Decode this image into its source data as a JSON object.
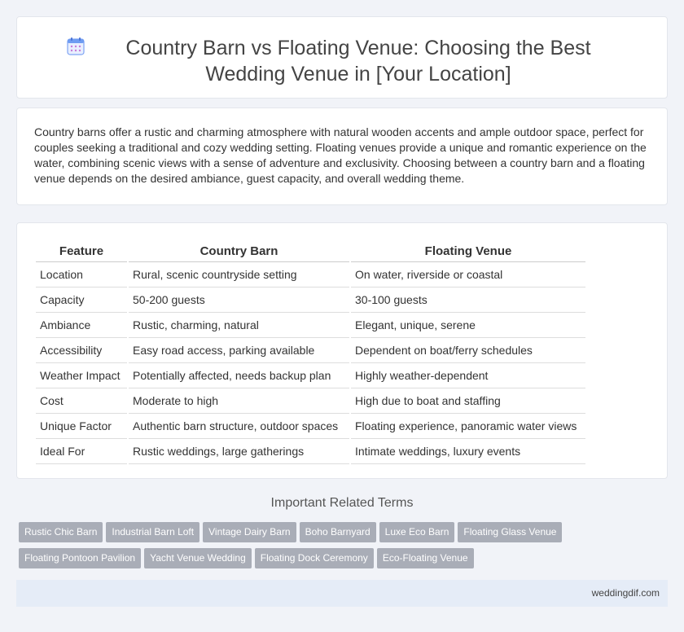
{
  "header": {
    "title": "Country Barn vs Floating Venue: Choosing the Best Wedding Venue in [Your Location]",
    "icon": "calendar-icon"
  },
  "intro": {
    "text": "Country barns offer a rustic and charming atmosphere with natural wooden accents and ample outdoor space, perfect for couples seeking a traditional and cozy wedding setting. Floating venues provide a unique and romantic experience on the water, combining scenic views with a sense of adventure and exclusivity. Choosing between a country barn and a floating venue depends on the desired ambiance, guest capacity, and overall wedding theme."
  },
  "table": {
    "headers": [
      "Feature",
      "Country Barn",
      "Floating Venue"
    ],
    "rows": [
      [
        "Location",
        "Rural, scenic countryside setting",
        "On water, riverside or coastal"
      ],
      [
        "Capacity",
        "50-200 guests",
        "30-100 guests"
      ],
      [
        "Ambiance",
        "Rustic, charming, natural",
        "Elegant, unique, serene"
      ],
      [
        "Accessibility",
        "Easy road access, parking available",
        "Dependent on boat/ferry schedules"
      ],
      [
        "Weather Impact",
        "Potentially affected, needs backup plan",
        "Highly weather-dependent"
      ],
      [
        "Cost",
        "Moderate to high",
        "High due to boat and staffing"
      ],
      [
        "Unique Factor",
        "Authentic barn structure, outdoor spaces",
        "Floating experience, panoramic water views"
      ],
      [
        "Ideal For",
        "Rustic weddings, large gatherings",
        "Intimate weddings, luxury events"
      ]
    ]
  },
  "related": {
    "title": "Important Related Terms",
    "tags": [
      "Rustic Chic Barn",
      "Industrial Barn Loft",
      "Vintage Dairy Barn",
      "Boho Barnyard",
      "Luxe Eco Barn",
      "Floating Glass Venue",
      "Floating Pontoon Pavilion",
      "Yacht Venue Wedding",
      "Floating Dock Ceremony",
      "Eco-Floating Venue"
    ]
  },
  "footer": {
    "site": "weddingdif.com"
  },
  "colors": {
    "background": "#f1f3f8",
    "tag": "#a9adb7",
    "footer": "#e5ecf7",
    "icon_accent": "#5b8def"
  }
}
